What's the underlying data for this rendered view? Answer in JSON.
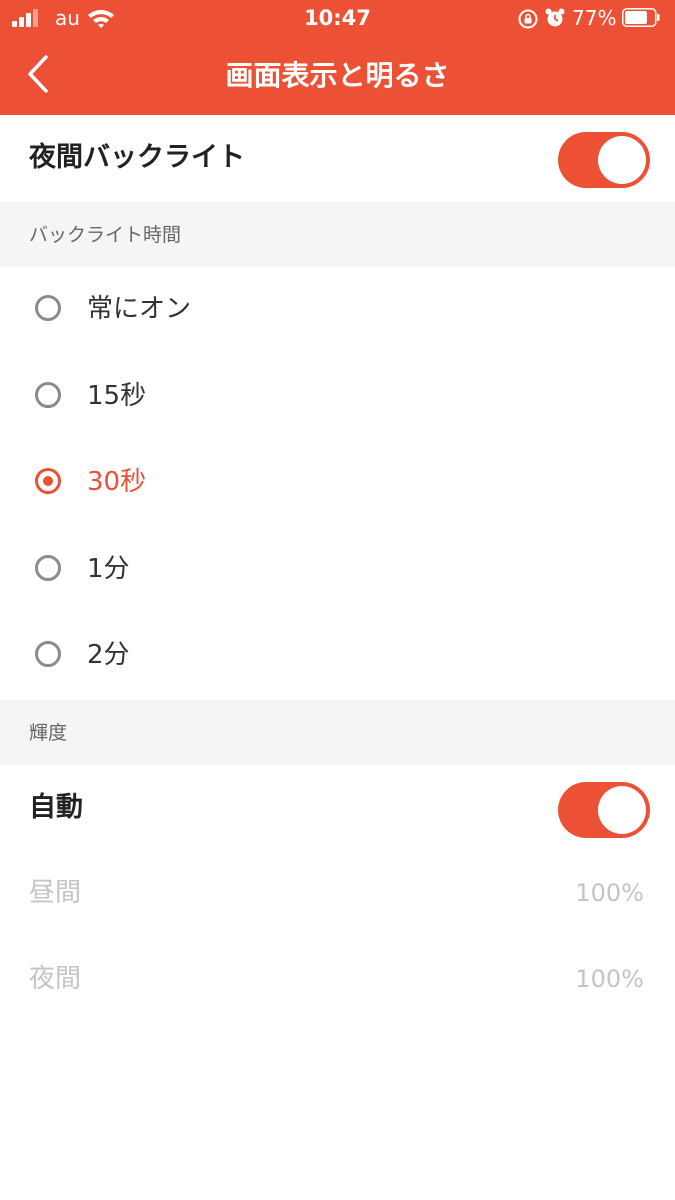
{
  "status_bar": {
    "carrier": "au",
    "time": "10:47",
    "battery_percent": "77%",
    "battery_level": 0.77
  },
  "nav": {
    "title": "画面表示と明るさ"
  },
  "night_backlight": {
    "label": "夜間バックライト",
    "enabled": true
  },
  "backlight_section": {
    "header": "バックライト時間",
    "options": [
      {
        "label": "常にオン",
        "selected": false
      },
      {
        "label": "15秒",
        "selected": false
      },
      {
        "label": "30秒",
        "selected": true
      },
      {
        "label": "1分",
        "selected": false
      },
      {
        "label": "2分",
        "selected": false
      }
    ]
  },
  "brightness_section": {
    "header": "輝度",
    "auto_label": "自動",
    "auto_enabled": true,
    "items": [
      {
        "label": "昼間",
        "value": "100%"
      },
      {
        "label": "夜間",
        "value": "100%"
      }
    ]
  },
  "colors": {
    "accent": "#ec5135",
    "section_bg": "#f5f5f5",
    "disabled_text": "#c4c4c4"
  },
  "icons": {
    "back": "chevron-left-icon",
    "signal": "cellular-signal-icon",
    "wifi": "wifi-icon",
    "rotation_lock": "rotation-lock-icon",
    "alarm": "alarm-clock-icon",
    "battery": "battery-icon"
  }
}
